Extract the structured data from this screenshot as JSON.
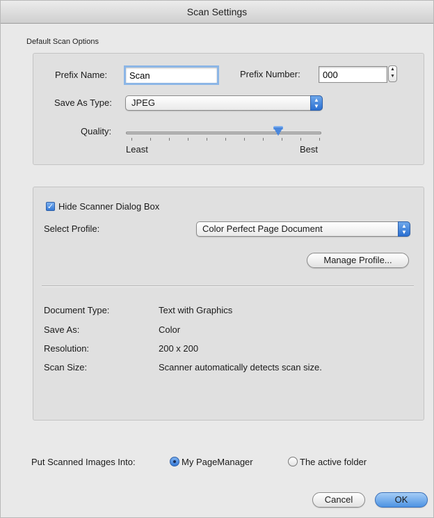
{
  "window": {
    "title": "Scan Settings"
  },
  "section_label": "Default Scan Options",
  "options": {
    "prefix_name_label": "Prefix Name:",
    "prefix_name_value": "Scan",
    "prefix_number_label": "Prefix Number:",
    "prefix_number_value": "000",
    "save_as_type_label": "Save As Type:",
    "save_as_type_value": "JPEG",
    "quality_label": "Quality:",
    "quality_min_label": "Least",
    "quality_max_label": "Best",
    "quality_level": 0.78
  },
  "profile": {
    "hide_dialog_label": "Hide Scanner Dialog Box",
    "hide_dialog_checked": true,
    "select_profile_label": "Select Profile:",
    "select_profile_value": "Color Perfect Page Document",
    "manage_button": "Manage Profile...",
    "details": [
      {
        "label": "Document Type:",
        "value": "Text with Graphics"
      },
      {
        "label": "Save As:",
        "value": "Color"
      },
      {
        "label": "Resolution:",
        "value": "200 x 200"
      },
      {
        "label": "Scan Size:",
        "value": "Scanner automatically detects scan size."
      }
    ]
  },
  "destination": {
    "label": "Put Scanned Images Into:",
    "options": [
      "My PageManager",
      "The active folder"
    ],
    "selected": "My PageManager"
  },
  "buttons": {
    "cancel": "Cancel",
    "ok": "OK"
  },
  "colors": {
    "accent": "#3579d6",
    "focus_ring": "#8cb6e6",
    "panel": "#e0e0e0"
  },
  "icons": {
    "popup": "updown-chevron-icon",
    "stepper": "stepper-arrows-icon",
    "check": "checkmark-icon"
  }
}
